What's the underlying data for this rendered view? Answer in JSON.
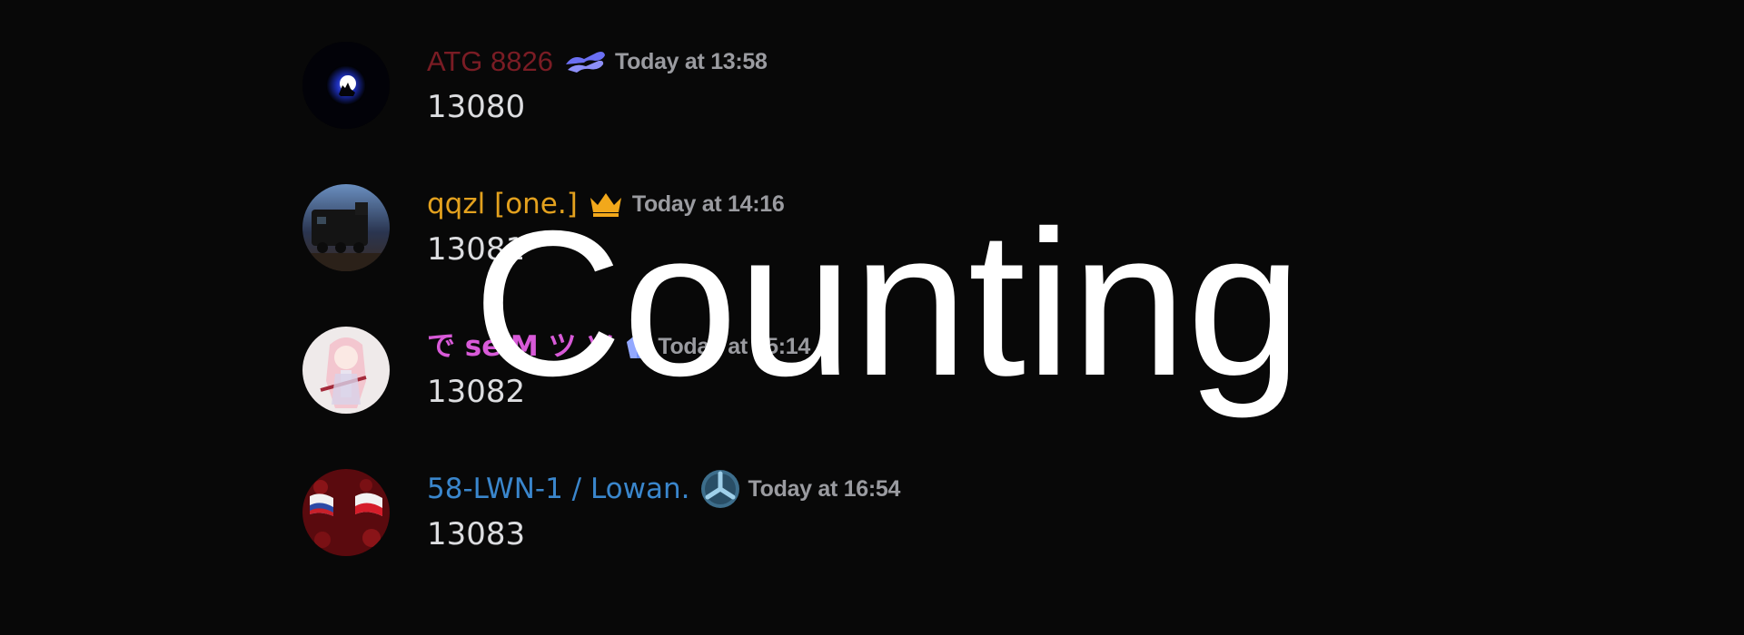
{
  "messages": [
    {
      "username": "ATG 8826",
      "username_color": "#7a1c24",
      "badge_icon": "nitro-badge-icon",
      "timestamp": "Today at 13:58",
      "content": "13080"
    },
    {
      "username": "qqzl [one.]",
      "username_color": "#e3a11e",
      "badge_icon": "crown-icon",
      "timestamp": "Today at 14:16",
      "content": "13081"
    },
    {
      "username": "で seiM ツ ツ",
      "username_color": "#d85ad8",
      "badge_icon": "boost-gem-icon",
      "timestamp": "Today at 15:14",
      "content": "13082"
    },
    {
      "username": "58-LWN-1 / Lowan.",
      "username_color": "#3a86cc",
      "badge_icon": "y-emblem-icon",
      "timestamp": "Today at 16:54",
      "content": "13083"
    }
  ],
  "overlay": {
    "title": "Counting",
    "color": "#ffffff"
  },
  "colors": {
    "background": "#080808",
    "timestamp": "#9a9ba0",
    "content": "#dcdde0"
  }
}
